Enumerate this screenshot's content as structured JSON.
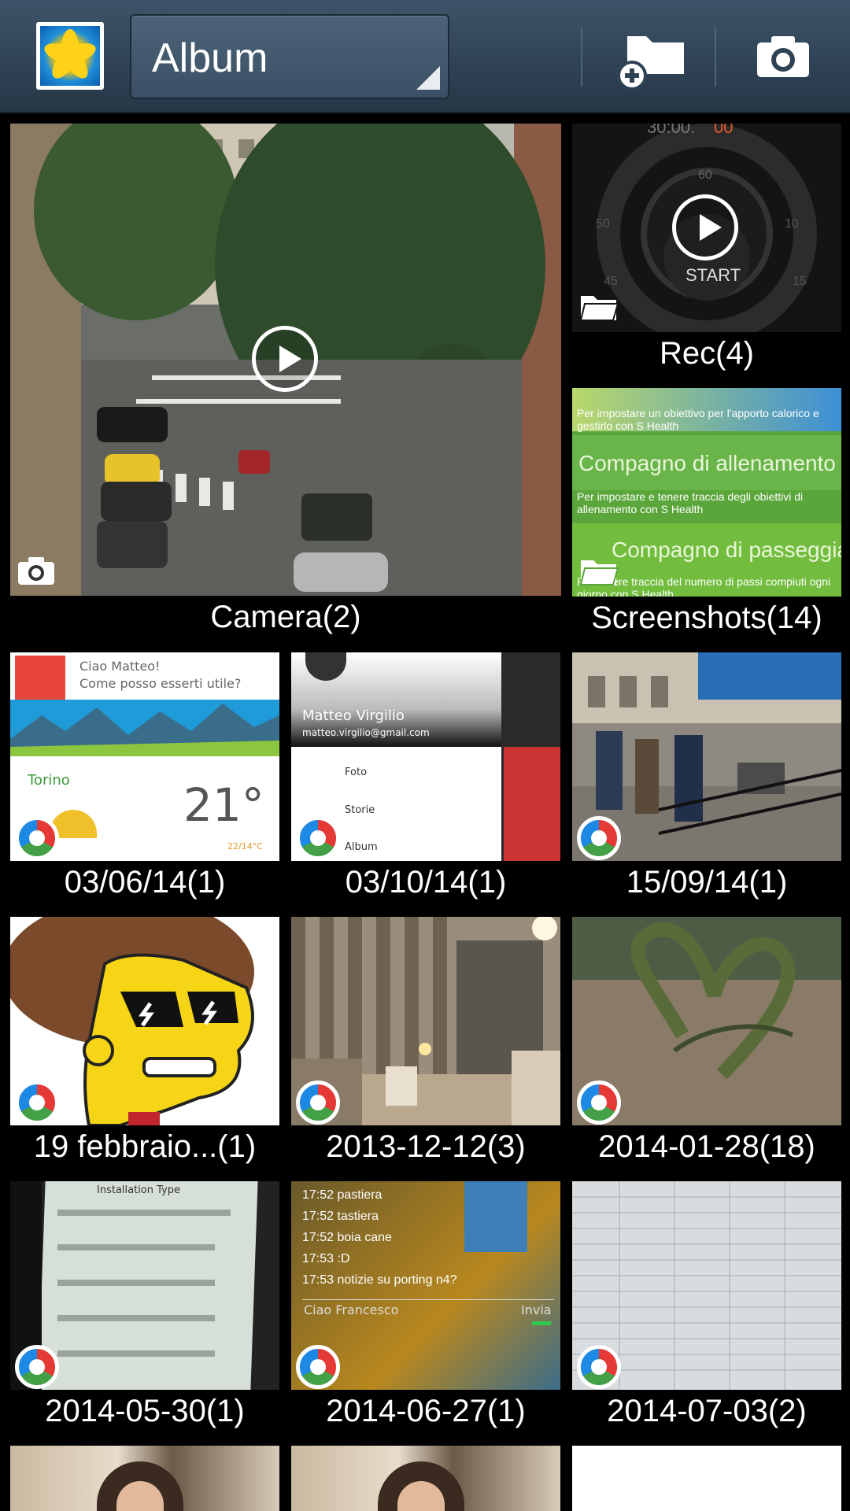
{
  "actionbar": {
    "album_label": "Album",
    "new_album_icon": "folder-plus-icon",
    "camera_icon": "camera-icon"
  },
  "albums": [
    {
      "caption": "Camera(2)",
      "badge": "camera-icon",
      "video": true
    },
    {
      "caption": "Rec(4)",
      "badge": "folder-icon",
      "video": true,
      "start_label": "START"
    },
    {
      "caption": "Screenshots(14)",
      "badge": "folder-icon",
      "lines": [
        "Per impostare un obiettivo per l'apporto calorico e gestirlo con S Health",
        "Compagno di allenamento",
        "Per impostare e tenere traccia degli obiettivi di allenamento con S Health",
        "Compagno di passeggiata",
        "Per tenere traccia del numero di passi compiuti ogni giorno con S Health"
      ]
    },
    {
      "caption": "03/06/14(1)",
      "badge": "picasa-icon",
      "card_text": "Ciao Matteo!",
      "card_sub": "Come posso esserti utile?",
      "city": "Torino",
      "temp": "21°",
      "range": "22/14°C"
    },
    {
      "caption": "03/10/14(1)",
      "badge": "picasa-icon",
      "name": "Matteo Virgilio",
      "email": "matteo.virgilio@gmail.com",
      "menu": [
        "Foto",
        "Storie",
        "Album"
      ]
    },
    {
      "caption": "15/09/14(1)",
      "badge": "picasa-icon"
    },
    {
      "caption": "19 febbraio...(1)",
      "badge": "picasa-icon"
    },
    {
      "caption": "2013-12-12(3)",
      "badge": "picasa-icon"
    },
    {
      "caption": "2014-01-28(18)",
      "badge": "picasa-icon"
    },
    {
      "caption": "2014-05-30(1)",
      "badge": "picasa-icon",
      "title": "Installation Type"
    },
    {
      "caption": "2014-06-27(1)",
      "badge": "picasa-icon",
      "chat": [
        {
          "time": "17:52",
          "text": "pastiera"
        },
        {
          "time": "17:52",
          "text": "tastiera"
        },
        {
          "time": "17:52",
          "text": "boia cane"
        },
        {
          "time": "17:53",
          "text": ":D"
        },
        {
          "time": "17:53",
          "text": "notizie su porting n4?"
        }
      ],
      "input": "Ciao Francesco",
      "send": "Invia"
    },
    {
      "caption": "2014-07-03(2)",
      "badge": "picasa-icon"
    }
  ],
  "colors": {
    "actionbar": "#344a5e",
    "background": "#000000",
    "caption": "#ffffff"
  }
}
